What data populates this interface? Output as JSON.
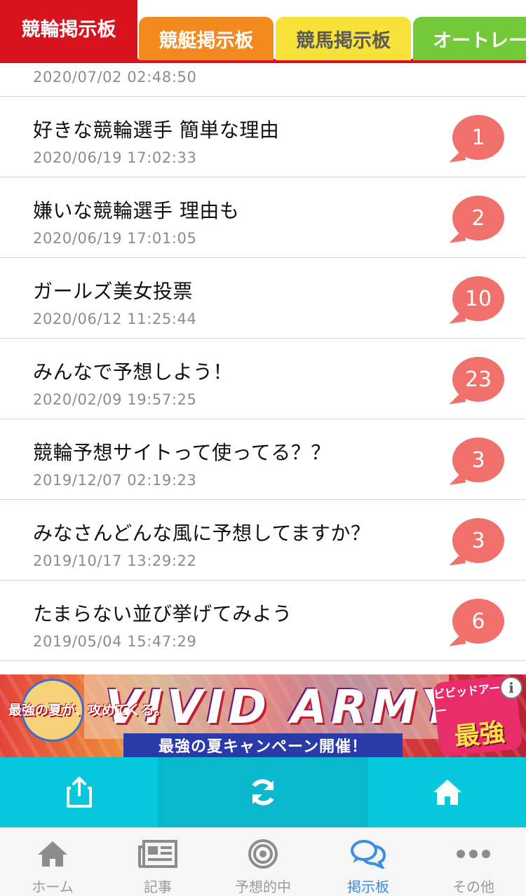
{
  "tabs": [
    {
      "label": "競輪掲示板",
      "active": true,
      "color": "#d7141e"
    },
    {
      "label": "競艇掲示板",
      "active": false,
      "color": "#f28a1f"
    },
    {
      "label": "競馬掲示板",
      "active": false,
      "color": "#f8e23a"
    },
    {
      "label": "オートレース",
      "active": false,
      "color": "#74c93a"
    }
  ],
  "threads": {
    "partial_date": "2020/07/02 02:48:50",
    "items": [
      {
        "title": "好きな競輪選手 簡単な理由",
        "date": "2020/06/19 17:02:33",
        "count": "1"
      },
      {
        "title": "嫌いな競輪選手 理由も",
        "date": "2020/06/19 17:01:05",
        "count": "2"
      },
      {
        "title": "ガールズ美女投票",
        "date": "2020/06/12 11:25:44",
        "count": "10"
      },
      {
        "title": "みんなで予想しよう！",
        "date": "2020/02/09 19:57:25",
        "count": "23"
      },
      {
        "title": "競輪予想サイトって使ってる？？",
        "date": "2019/12/07 02:19:23",
        "count": "3"
      },
      {
        "title": "みなさんどんな風に予想してますか？",
        "date": "2019/10/17 13:29:22",
        "count": "3"
      },
      {
        "title": "たまらない並び挙げてみよう",
        "date": "2019/05/04 15:47:29",
        "count": "6"
      }
    ],
    "bubble_color": "#f0716b"
  },
  "ad": {
    "logo": "VIVID ARMY",
    "left_tagline": "最強の夏が、攻めてくる。",
    "campaign": "最強の夏キャンペーン開催！",
    "badge_top": "ビビッドアーミー",
    "badge_main": "最強",
    "info": "i"
  },
  "actionbar": {
    "color": "#07c7dd",
    "buttons": [
      {
        "icon": "share-icon"
      },
      {
        "icon": "refresh-icon"
      },
      {
        "icon": "home-icon"
      }
    ]
  },
  "bottomnav": {
    "items": [
      {
        "label": "ホーム",
        "icon": "home-icon",
        "active": false
      },
      {
        "label": "記事",
        "icon": "newspaper-icon",
        "active": false
      },
      {
        "label": "予想的中",
        "icon": "target-icon",
        "active": false
      },
      {
        "label": "掲示板",
        "icon": "chat-bubbles-icon",
        "active": true
      },
      {
        "label": "その他",
        "icon": "more-icon",
        "active": false
      }
    ],
    "active_color": "#3a8ee6"
  }
}
